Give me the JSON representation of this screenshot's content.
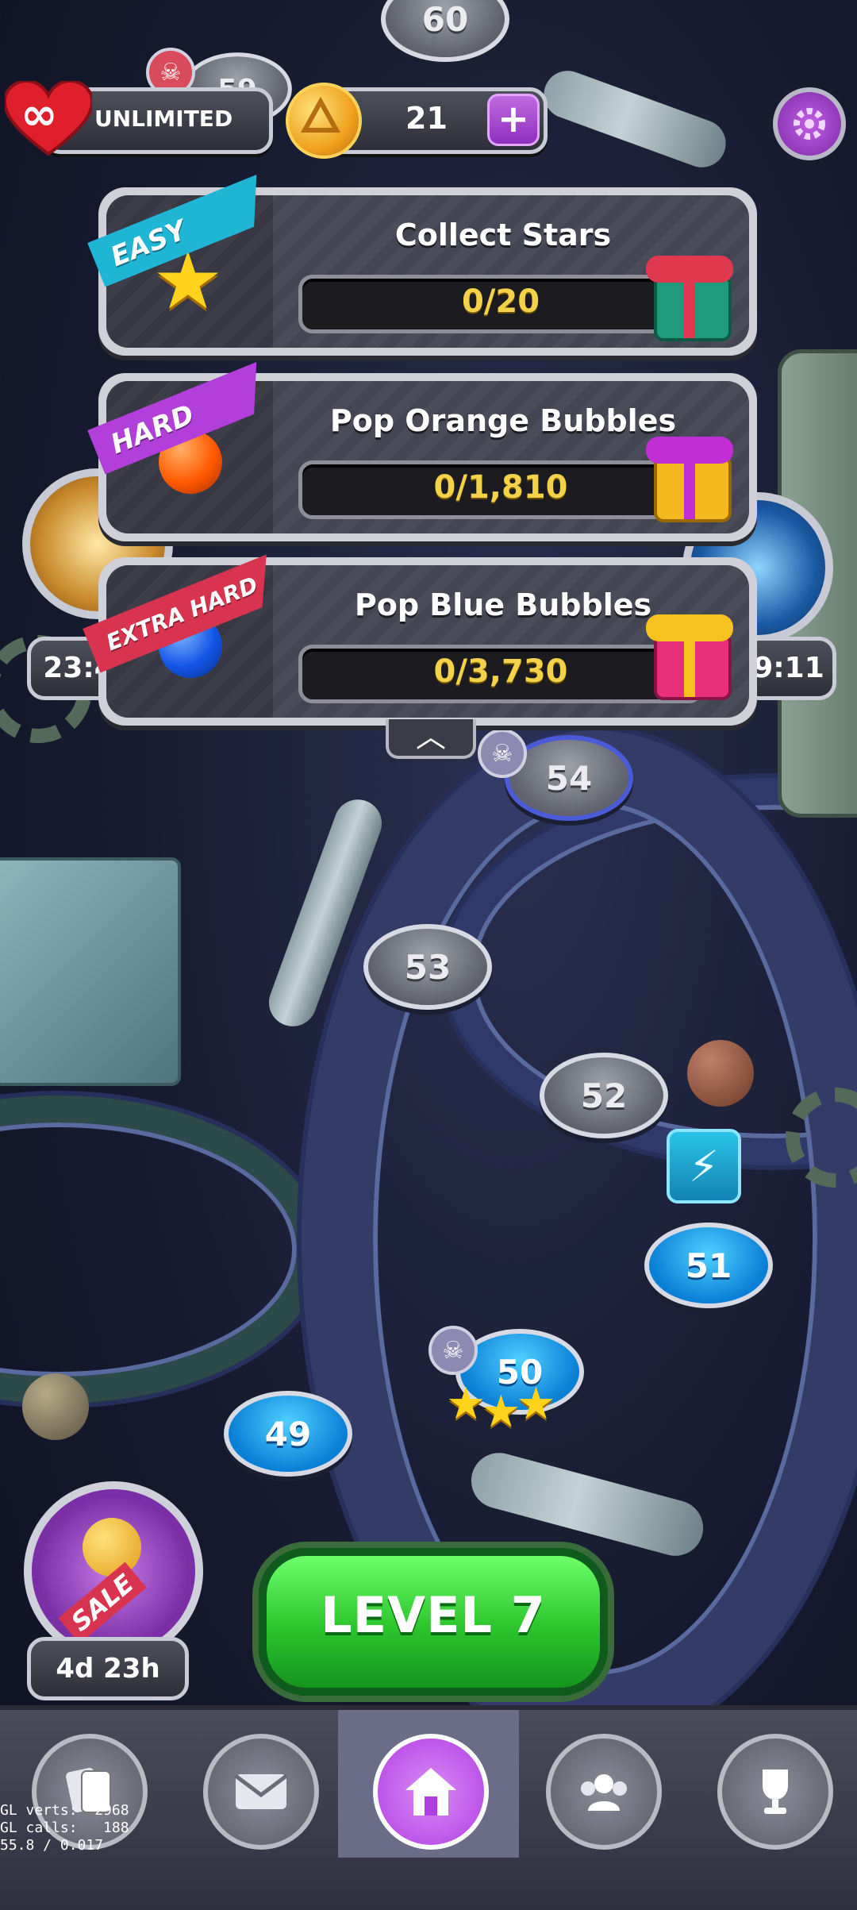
{
  "top_bar": {
    "lives_label": "UNLIMITED",
    "coins": "21",
    "plus": "+",
    "infinity": "∞"
  },
  "quests": [
    {
      "difficulty": "EASY",
      "title": "Collect Stars",
      "progress_text": "0/20",
      "progress": 0
    },
    {
      "difficulty": "HARD",
      "title": "Pop Orange Bubbles",
      "progress_text": "0/1,810",
      "progress": 0
    },
    {
      "difficulty": "EXTRA HARD",
      "title": "Pop Blue Bubbles",
      "progress_text": "0/3,730",
      "progress": 0
    }
  ],
  "side_timers": {
    "left": "23:4",
    "right": "9:11"
  },
  "levels": {
    "l60": "60",
    "l59": "59",
    "l54": "54",
    "l53": "53",
    "l52": "52",
    "l51": "51",
    "l50": "50",
    "l49": "49"
  },
  "level50_stars": 3,
  "sale": {
    "badge": "SALE",
    "timer": "4d 23h"
  },
  "play_button": "LEVEL 7",
  "nav": {
    "items": [
      "cards-icon",
      "mail-icon",
      "home-icon",
      "team-icon",
      "trophy-icon"
    ],
    "active": "home-icon"
  },
  "debug": {
    "line1": "GL verts:  2968",
    "line2": "GL calls:   188",
    "line3": "55.8 / 0.017"
  },
  "colors": {
    "easy": "#1fb6d6",
    "hard": "#b23fd9",
    "extra_hard": "#d8344f",
    "play": "#2cc42c",
    "open_node": "#0a7fd6"
  }
}
